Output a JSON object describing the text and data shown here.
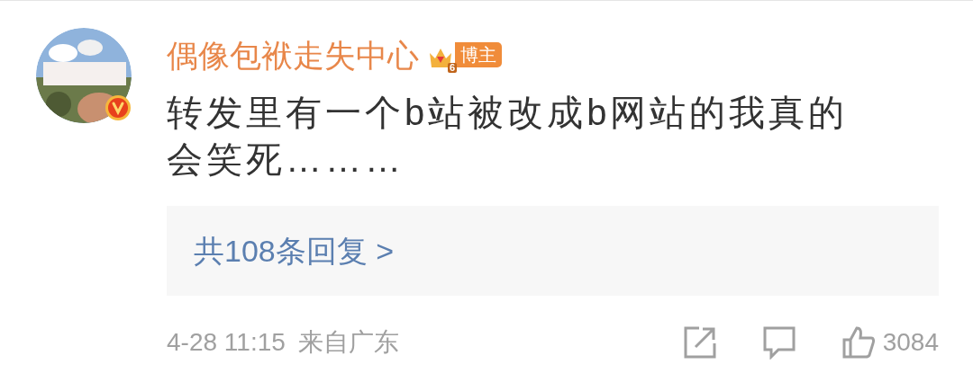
{
  "comment": {
    "author": "偶像包袱走失中心",
    "badge": {
      "level": "6",
      "label": "博主"
    },
    "verified": true,
    "text": "转发里有一个b站被改成b网站的我真的会笑死………",
    "replies_link": "共108条回复 >",
    "time": "4-28 11:15",
    "location": "来自广东",
    "likes": "3084"
  }
}
